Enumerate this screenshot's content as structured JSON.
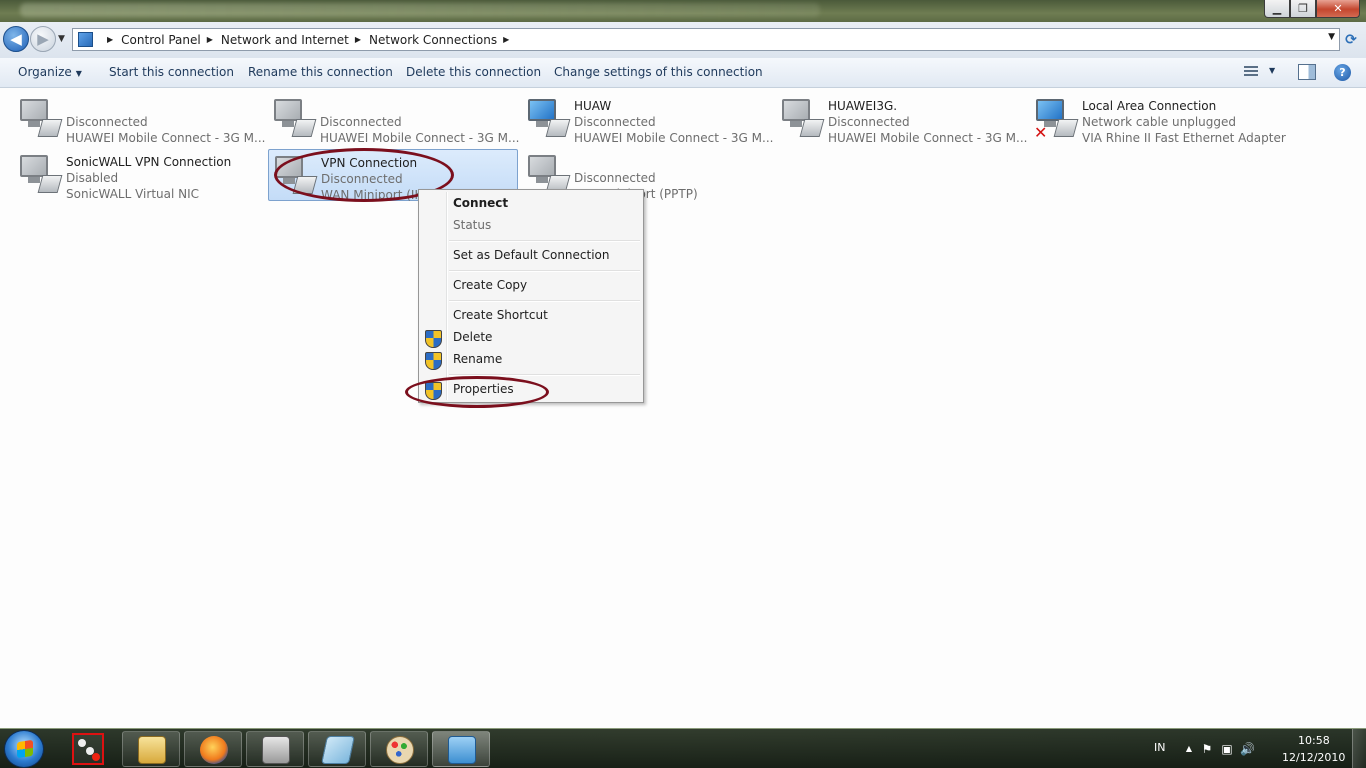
{
  "window": {
    "minimize_glyph": "▁",
    "maximize_glyph": "❐",
    "close_glyph": "✕"
  },
  "address": {
    "breadcrumbs": [
      "Control Panel",
      "Network and Internet",
      "Network Connections"
    ],
    "separator": "▶",
    "dropdown_glyph": "▼",
    "back_glyph": "◀",
    "forward_glyph": "▶",
    "recent_glyph": "▼",
    "refresh_glyph": "⟳"
  },
  "toolbar": {
    "organize": "Organize",
    "organize_caret": "▼",
    "start": "Start this connection",
    "rename": "Rename this connection",
    "delete": "Delete this connection",
    "change": "Change settings of this connection",
    "view_caret": "▼",
    "help": "?"
  },
  "connections": [
    {
      "name": "",
      "status": "Disconnected",
      "device": "HUAWEI Mobile Connect - 3G M...",
      "icon": "grey"
    },
    {
      "name": "",
      "status": "Disconnected",
      "device": "HUAWEI Mobile Connect - 3G M...",
      "icon": "grey"
    },
    {
      "name": "HUAW",
      "status": "Disconnected",
      "device": "HUAWEI Mobile Connect - 3G M...",
      "icon": "blue"
    },
    {
      "name": "HUAWEI3G.",
      "status": "Disconnected",
      "device": "HUAWEI Mobile Connect - 3G M...",
      "icon": "grey"
    },
    {
      "name": "Local Area Connection",
      "status": "Network cable unplugged",
      "device": "VIA Rhine II Fast Ethernet Adapter",
      "icon": "blue",
      "x_mark": "✕"
    },
    {
      "name": "SonicWALL VPN Connection",
      "status": "Disabled",
      "device": "SonicWALL Virtual NIC",
      "icon": "grey"
    },
    {
      "name": "VPN Connection",
      "status": "Disconnected",
      "device": "WAN Miniport (IKE",
      "icon": "grey"
    },
    {
      "name": "",
      "status": "Disconnected",
      "device": "WAN Miniport (PPTP)",
      "icon": "grey"
    }
  ],
  "context_menu": {
    "connect": "Connect",
    "status": "Status",
    "set_default": "Set as Default Connection",
    "create_copy": "Create Copy",
    "create_shortcut": "Create Shortcut",
    "delete": "Delete",
    "rename": "Rename",
    "properties": "Properties"
  },
  "taskbar": {
    "language": "IN",
    "time": "10:58",
    "date": "12/12/2010",
    "tray_up_glyph": "▲",
    "flag_glyph": "⚑",
    "network_glyph": "▣",
    "volume_glyph": "🔊"
  }
}
